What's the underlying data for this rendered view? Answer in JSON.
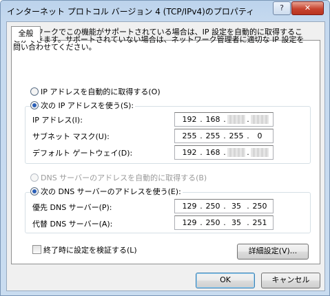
{
  "window": {
    "title": "インターネット プロトコル バージョン 4 (TCP/IPv4)のプロパティ",
    "help_glyph": "?",
    "close_glyph": "✕"
  },
  "tabs": [
    {
      "label": "全般"
    }
  ],
  "description": "ネットワークでこの機能がサポートされている場合は、IP 設定を自動的に取得することができます。サポートされていない場合は、ネットワーク管理者に適切な IP 設定を問い合わせてください。",
  "ip_section": {
    "auto_label": "IP アドレスを自動的に取得する(O)",
    "manual_label": "次の IP アドレスを使う(S):",
    "selected": "manual",
    "fields": [
      {
        "label": "IP アドレス(I):",
        "octets": [
          "192",
          "168",
          "",
          ""
        ],
        "masked": [
          false,
          false,
          true,
          true
        ]
      },
      {
        "label": "サブネット マスク(U):",
        "octets": [
          "255",
          "255",
          "255",
          "0"
        ],
        "masked": [
          false,
          false,
          false,
          false
        ]
      },
      {
        "label": "デフォルト ゲートウェイ(D):",
        "octets": [
          "192",
          "168",
          "",
          ""
        ],
        "masked": [
          false,
          false,
          true,
          true
        ]
      }
    ]
  },
  "dns_section": {
    "auto_label": "DNS サーバーのアドレスを自動的に取得する(B)",
    "manual_label": "次の DNS サーバーのアドレスを使う(E):",
    "selected": "manual",
    "auto_disabled": true,
    "fields": [
      {
        "label": "優先 DNS サーバー(P):",
        "octets": [
          "129",
          "250",
          "35",
          "250"
        ],
        "masked": [
          false,
          false,
          false,
          false
        ]
      },
      {
        "label": "代替 DNS サーバー(A):",
        "octets": [
          "129",
          "250",
          "35",
          "251"
        ],
        "masked": [
          false,
          false,
          false,
          false
        ]
      }
    ]
  },
  "validate_checkbox": {
    "label": "終了時に設定を検証する(L)",
    "checked": false
  },
  "buttons": {
    "advanced": "詳細設定(V)...",
    "ok": "OK",
    "cancel": "キャンセル"
  }
}
